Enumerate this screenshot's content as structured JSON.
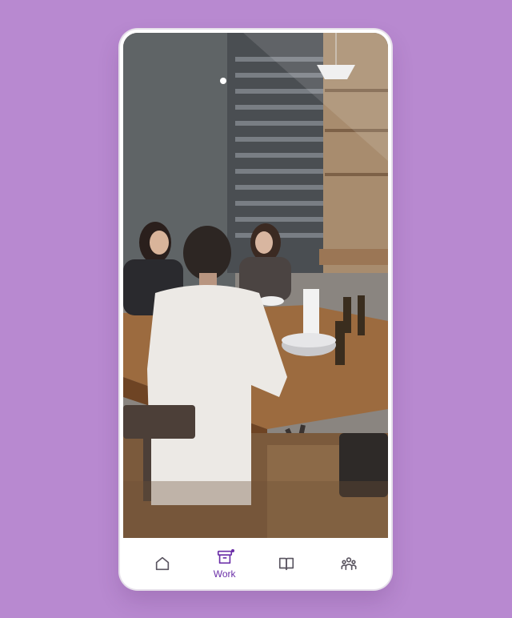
{
  "background_color": "#b889d0",
  "accent_color": "#6b2fa8",
  "photo": {
    "subject": "people-at-table-photo"
  },
  "tabbar": {
    "tabs": [
      {
        "icon": "home-icon",
        "label": "",
        "active": false
      },
      {
        "icon": "archive-box-icon",
        "label": "Work",
        "active": true,
        "badge": true
      },
      {
        "icon": "book-icon",
        "label": "",
        "active": false
      },
      {
        "icon": "people-icon",
        "label": "",
        "active": false
      }
    ]
  }
}
